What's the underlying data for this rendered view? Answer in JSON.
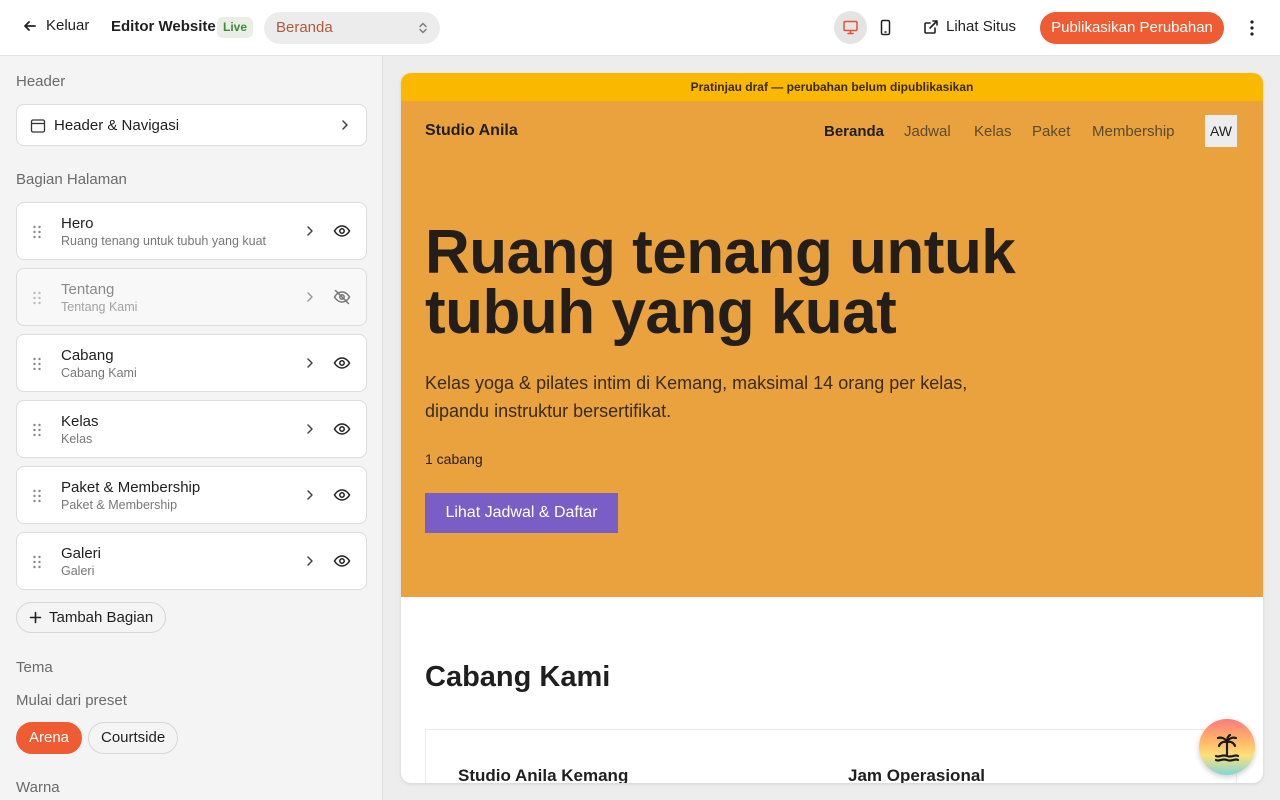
{
  "topbar": {
    "back_label": "Keluar",
    "title": "Editor Website",
    "status_badge": "Live",
    "page_select": "Beranda",
    "view_site_label": "Lihat Situs",
    "publish_label": "Publikasikan Perubahan"
  },
  "sidebar": {
    "header_section_title": "Header",
    "header_item_label": "Header & Navigasi",
    "sections_title": "Bagian Halaman",
    "sections": [
      {
        "name": "Hero",
        "subtitle": "Ruang tenang untuk tubuh yang kuat",
        "visible": true
      },
      {
        "name": "Tentang",
        "subtitle": "Tentang Kami",
        "visible": false
      },
      {
        "name": "Cabang",
        "subtitle": "Cabang Kami",
        "visible": true
      },
      {
        "name": "Kelas",
        "subtitle": "Kelas",
        "visible": true
      },
      {
        "name": "Paket & Membership",
        "subtitle": "Paket & Membership",
        "visible": true
      },
      {
        "name": "Galeri",
        "subtitle": "Galeri",
        "visible": true
      }
    ],
    "add_section_label": "Tambah Bagian",
    "theme_title": "Tema",
    "preset_subtitle": "Mulai dari preset",
    "presets": [
      "Arena",
      "Courtside"
    ],
    "color_title": "Warna"
  },
  "preview": {
    "draft_notice": "Pratinjau draf — perubahan belum dipublikasikan",
    "brand": "Studio Anila",
    "nav": [
      "Beranda",
      "Jadwal",
      "Kelas",
      "Paket",
      "Membership"
    ],
    "avatar_initials": "AW",
    "hero_title": "Ruang tenang untuk tubuh yang kuat",
    "hero_description": "Kelas yoga & pilates intim di Kemang, maksimal 14 orang per kelas, dipandu instruktur bersertifikat.",
    "branch_count": "1 cabang",
    "cta_label": "Lihat Jadwal & Daftar",
    "branches_title": "Cabang Kami",
    "branch_name": "Studio Anila Kemang",
    "hours_label": "Jam Operasional"
  },
  "colors": {
    "accent": "#ef5b32",
    "hero_bg": "#e9a23d",
    "draft_bar": "#fbb800",
    "cta": "#7a5ec5"
  }
}
